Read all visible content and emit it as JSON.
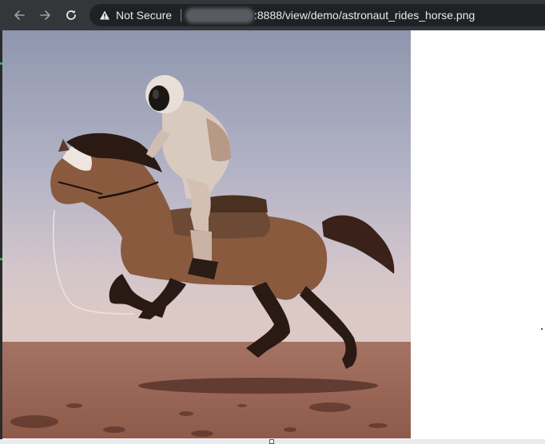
{
  "browser": {
    "security_label": "Not Secure",
    "url_path": ":8888/view/demo/astronaut_rides_horse.png",
    "icons": {
      "back": "back-arrow-icon",
      "forward": "forward-arrow-icon",
      "reload": "reload-icon",
      "security": "warning-triangle-icon"
    },
    "colors": {
      "toolbar": "#35363a",
      "omnibox": "#202124",
      "text": "#e8eaed"
    }
  },
  "image": {
    "description_icon": "photo-astronaut-on-horse"
  }
}
